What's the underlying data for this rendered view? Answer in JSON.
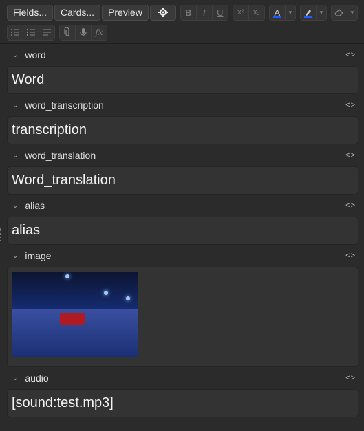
{
  "toolbar": {
    "fields_label": "Fields...",
    "cards_label": "Cards...",
    "preview_label": "Preview",
    "bold": "B",
    "italic": "I",
    "underline": "U",
    "superscript": "x²",
    "subscript": "x₂",
    "text_color_glyph": "A",
    "formula": "fx",
    "accent": "#1e5cff"
  },
  "fields": [
    {
      "name": "word",
      "value": "Word"
    },
    {
      "name": "word_transcription",
      "value": "transcription"
    },
    {
      "name": "word_translation",
      "value": "Word_translation"
    },
    {
      "name": "alias",
      "value": "alias"
    },
    {
      "name": "image",
      "value": ""
    },
    {
      "name": "audio",
      "value": "[sound:test.mp3]"
    }
  ],
  "html_toggle_glyph": "<>"
}
